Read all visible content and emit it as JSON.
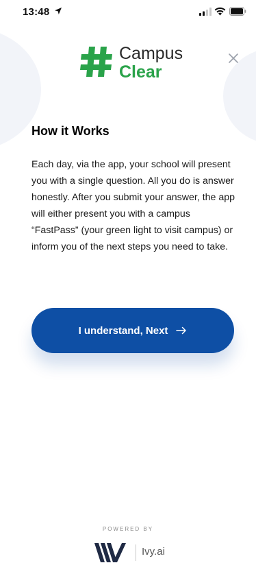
{
  "status_bar": {
    "time": "13:48",
    "location_icon": "location-arrow-icon",
    "signal_icon": "cellular-signal-icon",
    "wifi_icon": "wifi-icon",
    "battery_icon": "battery-icon"
  },
  "logo": {
    "word1": "Campus",
    "word2": "Clear",
    "hash_icon": "hashtag-icon",
    "hash_color": "#2aa34a"
  },
  "close_icon": "close-icon",
  "content": {
    "heading": "How it Works",
    "body": "Each day, via the app, your school will present you with a single question. All you do is answer honestly. After you submit your answer, the app will either present you with a campus “FastPass” (your green light to visit campus) or inform you of the next steps you need to take."
  },
  "next_button": {
    "label": "I understand, Next",
    "color": "#0e4fa5",
    "arrow_icon": "arrow-right-icon"
  },
  "footer": {
    "powered_by": "POWERED BY",
    "brand": "Ivy.ai",
    "mark_icon": "ivy-logo-icon"
  }
}
